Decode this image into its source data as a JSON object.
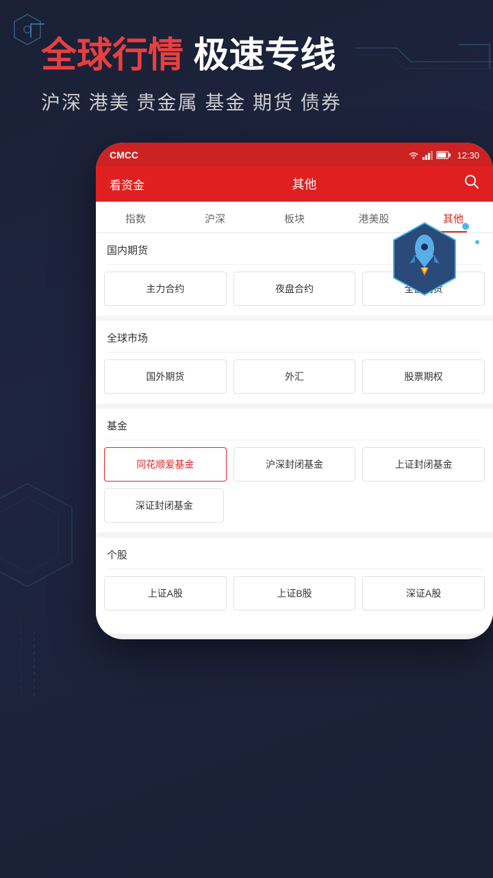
{
  "header": {
    "title_highlight": "全球行情",
    "title_rest": " 极速专线",
    "subtitle": "沪深 港美 贵金属 基金 期货 债券"
  },
  "status_bar": {
    "carrier": "CMCC",
    "time": "12:30"
  },
  "app_header": {
    "left_label": "看资金",
    "center_label": "其他",
    "search_icon": "search"
  },
  "tabs": [
    {
      "label": "指数",
      "active": false
    },
    {
      "label": "沪深",
      "active": false
    },
    {
      "label": "板块",
      "active": false
    },
    {
      "label": "港美股",
      "active": false
    },
    {
      "label": "其他",
      "active": true
    }
  ],
  "sections": [
    {
      "id": "domestic-futures",
      "title": "国内期货",
      "buttons": [
        {
          "label": "主力合约",
          "active": false
        },
        {
          "label": "夜盘合约",
          "active": false
        },
        {
          "label": "全部期货",
          "active": false
        }
      ]
    },
    {
      "id": "global-market",
      "title": "全球市场",
      "buttons": [
        {
          "label": "国外期货",
          "active": false
        },
        {
          "label": "外汇",
          "active": false
        },
        {
          "label": "股票期权",
          "active": false
        }
      ]
    },
    {
      "id": "funds",
      "title": "基金",
      "buttons": [
        {
          "label": "同花顺爱基金",
          "active": true
        },
        {
          "label": "沪深封闭基金",
          "active": false
        },
        {
          "label": "上证封闭基金",
          "active": false
        },
        {
          "label": "深证封闭基金",
          "active": false
        }
      ]
    },
    {
      "id": "individual-stocks",
      "title": "个股",
      "buttons": [
        {
          "label": "上证A股",
          "active": false
        },
        {
          "label": "上证B股",
          "active": false
        },
        {
          "label": "深证A股",
          "active": false
        }
      ]
    }
  ],
  "rocket_icon": "🚀",
  "colors": {
    "primary_red": "#e02020",
    "highlight_red": "#e84040",
    "dark_bg": "#1a2035",
    "accent_blue": "#4db8e8"
  }
}
